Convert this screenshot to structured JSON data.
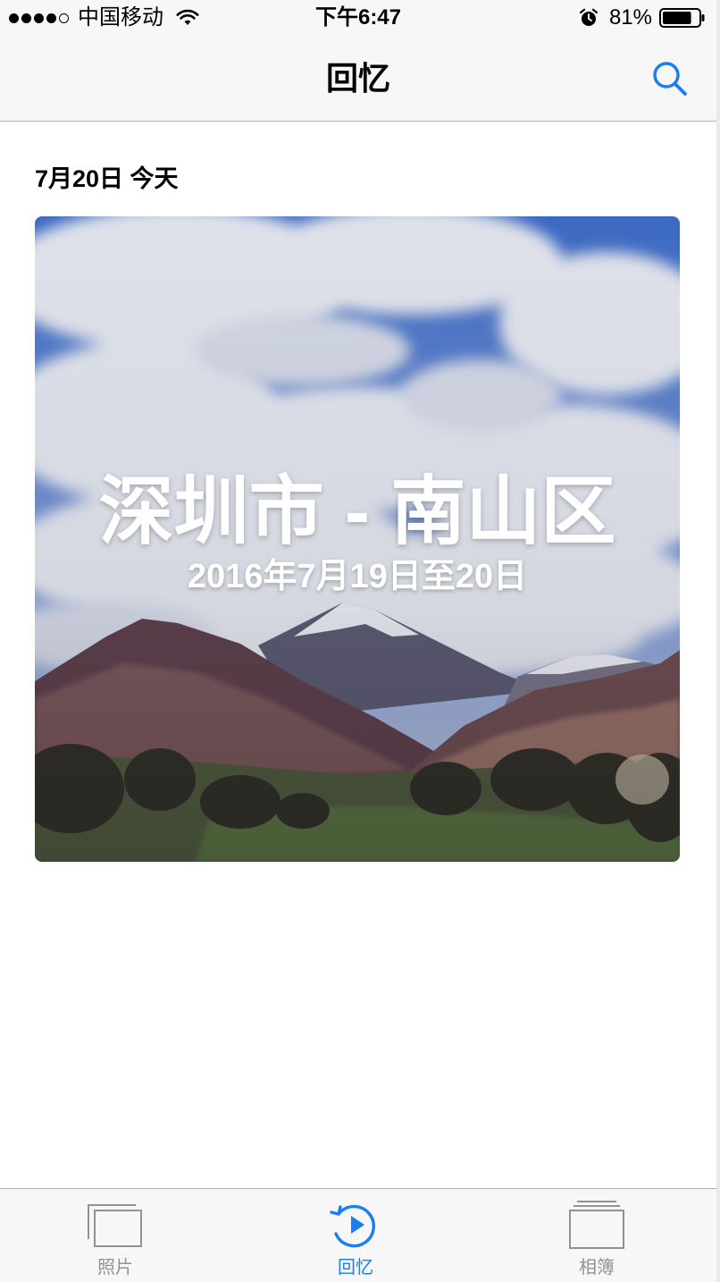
{
  "status_bar": {
    "carrier": "中国移动",
    "time": "下午6:47",
    "battery": "81%",
    "battery_level": 0.81,
    "signal_bars": 4,
    "signal_total": 5,
    "icons": [
      "wifi-icon",
      "alarm-icon",
      "battery-icon"
    ]
  },
  "nav": {
    "title": "回忆",
    "search_icon": "search-icon"
  },
  "section": {
    "date_label": "7月20日 今天"
  },
  "memory": {
    "title": "深圳市 - 南山区",
    "subtitle": "2016年7月19日至20日"
  },
  "tabs": [
    {
      "label": "照片",
      "icon": "photos-icon",
      "active": false
    },
    {
      "label": "回忆",
      "icon": "memories-icon",
      "active": true
    },
    {
      "label": "相簿",
      "icon": "albums-icon",
      "active": false
    }
  ],
  "colors": {
    "accent": "#1a7ef2",
    "inactive": "#929292",
    "bar_background": "#f7f7f7"
  }
}
